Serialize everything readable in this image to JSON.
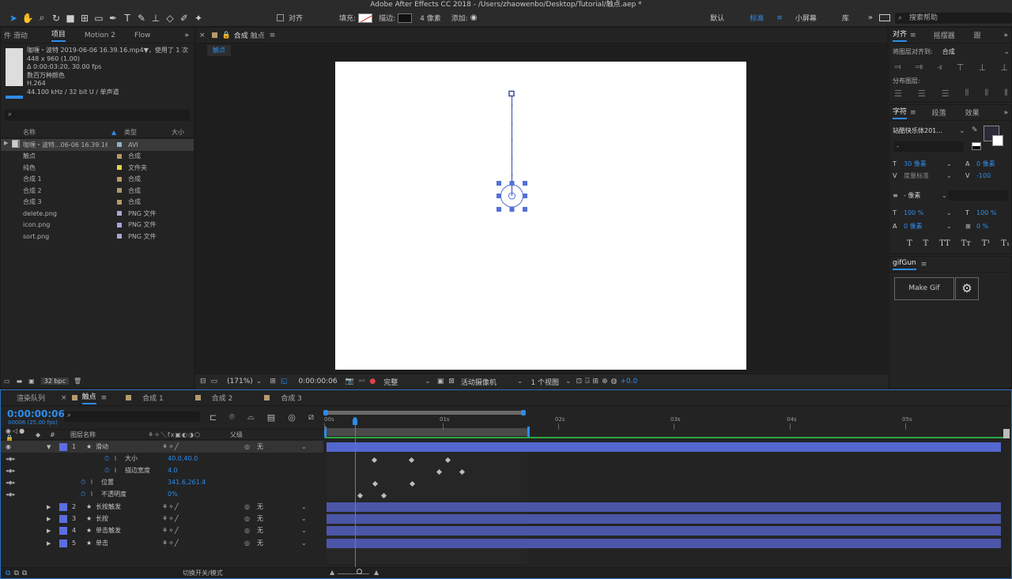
{
  "window_title": "Adobe After Effects CC 2018 - /Users/zhaowenbo/Desktop/Tutorial/触点.aep *",
  "toolbar": {
    "align_label": "对齐",
    "fill_label": "填充:",
    "stroke_label": "描边:",
    "stroke_width": "4 像素",
    "add_label": "添加:",
    "workspaces": [
      "默认",
      "标准",
      "小屏幕",
      "库"
    ],
    "active_workspace": "标准",
    "search_placeholder": "搜索帮助"
  },
  "project": {
    "tabs": [
      "件 滑动",
      "项目",
      "Motion 2",
      "Flow"
    ],
    "active_tab": "项目",
    "preview": {
      "filename": "咖喱・波特 2019-06-06 16.39.16.mp4▼，使用了 1 次",
      "dims": "448 x 960 (1.00)",
      "duration": "Δ 0:00:03:20, 30.00 fps",
      "colors": "数百万种颜色",
      "codec": "H.264",
      "audio": "44.100 kHz / 32 bit U / 单声道"
    },
    "search_placeholder": "",
    "col_name": "名称",
    "col_type": "类型",
    "col_size": "大小",
    "items": [
      {
        "name": "咖喱・波特...06-06 16.39.16.mp4",
        "type": "AVI",
        "color": "#8fb3c0"
      },
      {
        "name": "触点",
        "type": "合成",
        "color": "#b59a6b"
      },
      {
        "name": "纯色",
        "type": "文件夹",
        "color": "#e6d24a"
      },
      {
        "name": "合成 1",
        "type": "合成",
        "color": "#b59a6b"
      },
      {
        "name": "合成 2",
        "type": "合成",
        "color": "#b59a6b"
      },
      {
        "name": "合成 3",
        "type": "合成",
        "color": "#b59a6b"
      },
      {
        "name": "delete.png",
        "type": "PNG 文件",
        "color": "#a7a7d6"
      },
      {
        "name": "icon.png",
        "type": "PNG 文件",
        "color": "#a7a7d6"
      },
      {
        "name": "sort.png",
        "type": "PNG 文件",
        "color": "#a7a7d6"
      }
    ],
    "bpc": "32 bpc"
  },
  "viewer": {
    "tab_label": "合成",
    "comp_name": "触点",
    "crumb": "触点",
    "zoom": "(171%)",
    "timecode": "0:00:00:06",
    "quality": "完整",
    "camera": "活动摄像机",
    "views": "1 个视图",
    "exposure": "+0.0"
  },
  "align": {
    "tabs": [
      "对齐",
      "摇摆器",
      "跟"
    ],
    "align_to_label": "将图层对齐到:",
    "align_to_value": "合成",
    "distribute_label": "分布图层:"
  },
  "character": {
    "tabs": [
      "字符",
      "段落",
      "效果"
    ],
    "font": "站酷快乐体201...",
    "font_style": "-",
    "size": "30 像素",
    "leading": "0 像素",
    "kerning": "度量标准",
    "tracking": "-100",
    "stroke_size": "- 像素",
    "vscale": "100 %",
    "hscale": "100 %",
    "baseline": "0 像素",
    "tsume": "0 %",
    "styles": [
      "T",
      "T",
      "TT",
      "Tт",
      "T¹",
      "T₁"
    ]
  },
  "gifgun": {
    "title": "gifGun",
    "make_gif": "Make Gif"
  },
  "timeline": {
    "tabs": [
      "渲染队列",
      "触点",
      "合成 1",
      "合成 2",
      "合成 3"
    ],
    "active_tab": "触点",
    "timecode": "0:00:00:06",
    "frame_info": "00006 (25.00 fps)",
    "col_layer": "图层名称",
    "col_parent": "父级",
    "ruler": [
      "00s",
      "01s",
      "02s",
      "03s",
      "04s",
      "05s"
    ],
    "layers": [
      {
        "num": "1",
        "name": "滑动",
        "parent": "无"
      },
      {
        "num": "2",
        "name": "长按触发",
        "parent": "无"
      },
      {
        "num": "3",
        "name": "长按",
        "parent": "无"
      },
      {
        "num": "4",
        "name": "单击触发",
        "parent": "无"
      },
      {
        "num": "5",
        "name": "单击",
        "parent": "无"
      }
    ],
    "props": [
      {
        "name": "大小",
        "value": "40.0,40.0"
      },
      {
        "name": "描边宽度",
        "value": "4.0"
      },
      {
        "name": "位置",
        "value": "341.6,261.4"
      },
      {
        "name": "不透明度",
        "value": "0%"
      }
    ],
    "footer_toggle": "切换开关/模式"
  }
}
